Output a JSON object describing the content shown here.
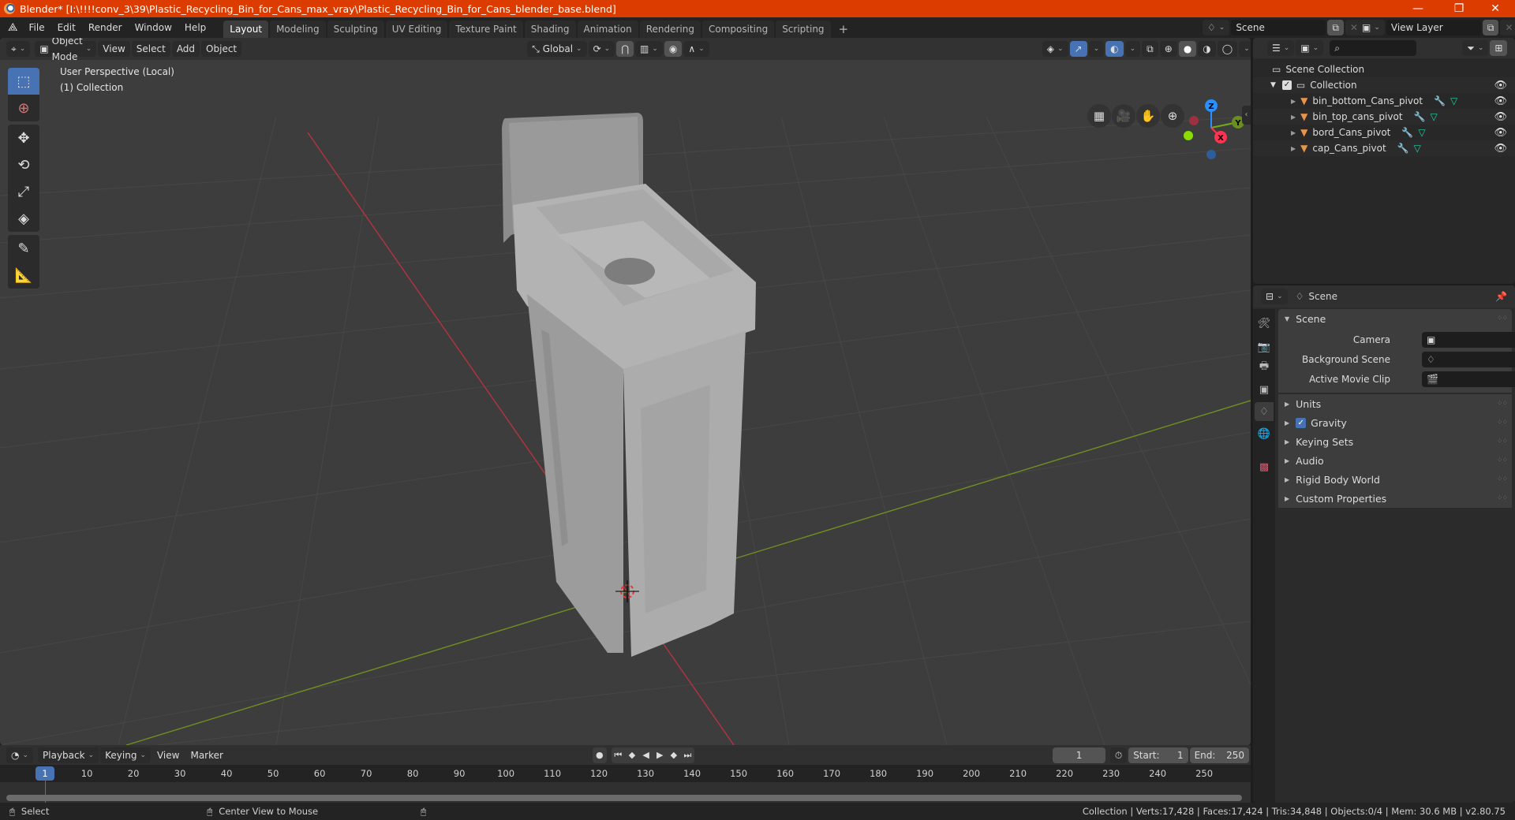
{
  "window": {
    "title": "Blender* [I:\\!!!!conv_3\\39\\Plastic_Recycling_Bin_for_Cans_max_vray\\Plastic_Recycling_Bin_for_Cans_blender_base.blend]",
    "controls": {
      "minimize": "—",
      "maximize": "❐",
      "close": "✕"
    }
  },
  "menu": {
    "items": [
      "File",
      "Edit",
      "Render",
      "Window",
      "Help"
    ]
  },
  "workspaces": {
    "tabs": [
      "Layout",
      "Modeling",
      "Sculpting",
      "UV Editing",
      "Texture Paint",
      "Shading",
      "Animation",
      "Rendering",
      "Compositing",
      "Scripting"
    ],
    "active": "Layout",
    "add_label": "+"
  },
  "scene_selector": {
    "value": "Scene"
  },
  "view_layer_selector": {
    "value": "View Layer"
  },
  "viewport_header": {
    "mode": "Object Mode",
    "menus": [
      "View",
      "Select",
      "Add",
      "Object"
    ],
    "transform_orientation": "Global"
  },
  "viewport": {
    "perspective_label": "User Perspective (Local)",
    "collection_label": "(1) Collection",
    "gizmo": {
      "z": "Z",
      "y": "Y",
      "x": "X"
    },
    "colors": {
      "x_axis": "#ff3352",
      "y_axis": "#8bdc00",
      "z_axis": "#2890ff",
      "grid_bg": "#3d3d3d",
      "model": "#a8a8a8"
    }
  },
  "tools": [
    "select-box",
    "cursor",
    "move",
    "rotate",
    "scale",
    "transform",
    "annotate",
    "measure"
  ],
  "outliner": {
    "search_placeholder": "",
    "root": "Scene Collection",
    "collection": "Collection",
    "objects": [
      {
        "name": "bin_bottom_Cans_pivot"
      },
      {
        "name": "bin_top_cans_pivot"
      },
      {
        "name": "bord_Cans_pivot"
      },
      {
        "name": "cap_Cans_pivot"
      }
    ]
  },
  "properties": {
    "header_title": "Scene",
    "panel_title": "Scene",
    "fields": [
      {
        "label": "Camera",
        "value": ""
      },
      {
        "label": "Background Scene",
        "value": ""
      },
      {
        "label": "Active Movie Clip",
        "value": ""
      }
    ],
    "sections": [
      "Units",
      "Gravity",
      "Keying Sets",
      "Audio",
      "Rigid Body World",
      "Custom Properties"
    ],
    "gravity_checked": true
  },
  "timeline": {
    "menus": [
      "Playback",
      "Keying",
      "View",
      "Marker"
    ],
    "current_frame": "1",
    "start_label": "Start:",
    "start": "1",
    "end_label": "End:",
    "end": "250",
    "ticks": [
      "10",
      "20",
      "30",
      "40",
      "50",
      "60",
      "70",
      "80",
      "90",
      "100",
      "110",
      "120",
      "130",
      "140",
      "150",
      "160",
      "170",
      "180",
      "190",
      "200",
      "210",
      "220",
      "230",
      "240",
      "250"
    ],
    "playhead": "1"
  },
  "statusbar": {
    "left_action": "Select",
    "middle_action": "Center View to Mouse",
    "stats": "Collection | Verts:17,428 | Faces:17,424 | Tris:34,848 | Objects:0/4 | Mem: 30.6 MB | v2.80.75"
  }
}
